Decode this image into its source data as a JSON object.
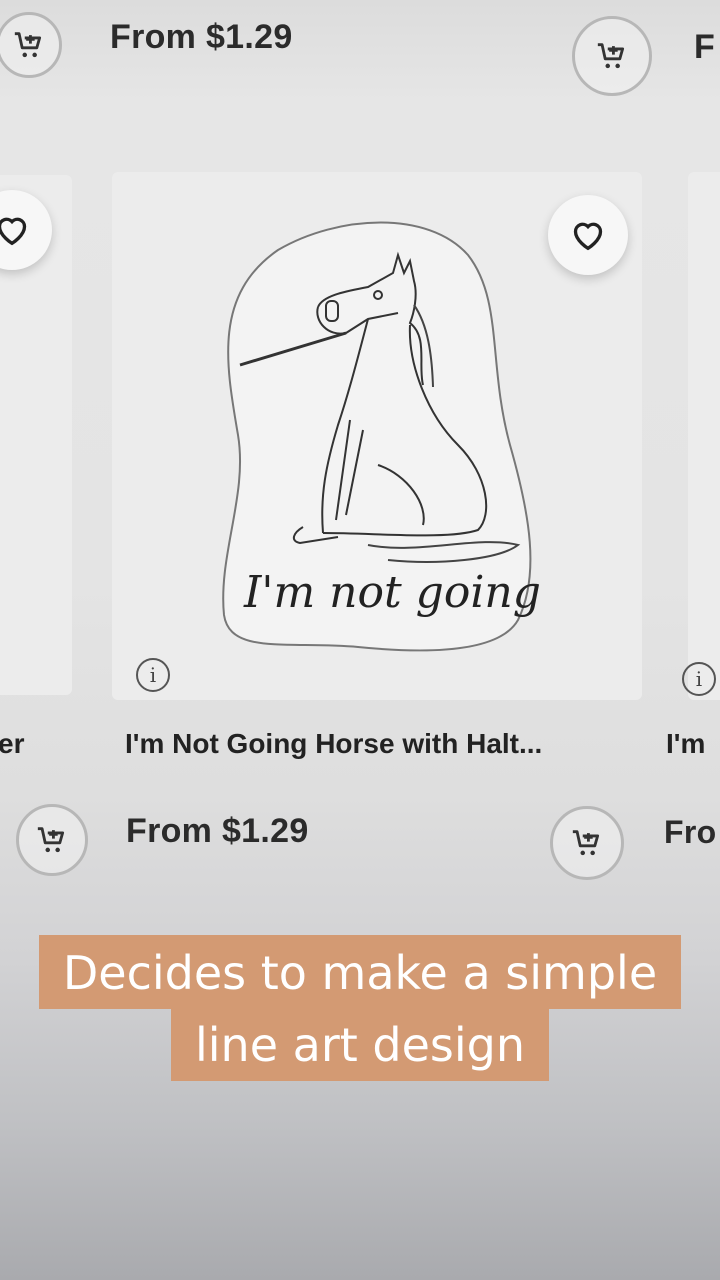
{
  "top_row": {
    "price_center": "From $1.29",
    "price_right_partial": "F"
  },
  "product": {
    "title": "I'm Not Going Horse with Halt...",
    "price": "From $1.29",
    "sticker_text": "I'm not going",
    "info_symbol": "i"
  },
  "left_card": {
    "title_partial": "er"
  },
  "right_card": {
    "title_partial": "I'm",
    "price_partial": "Fro",
    "info_symbol": "i"
  },
  "caption": {
    "line1": "Decides to make a simple",
    "line2": "line art design",
    "bg_color": "#d39a73"
  },
  "icons": {
    "cart": "add-to-cart-icon",
    "favorite": "heart-icon",
    "info": "info-icon"
  }
}
